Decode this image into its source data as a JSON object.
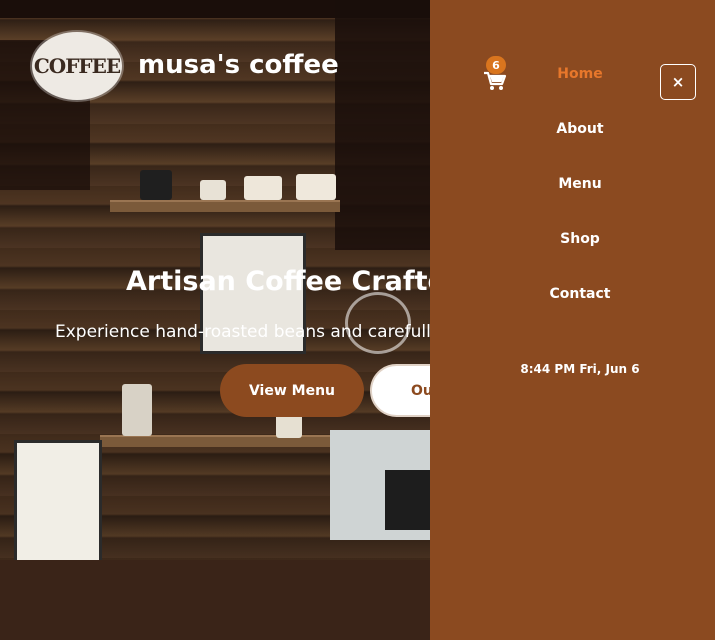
{
  "brand": {
    "logo_text": "COFFEE",
    "name": "musa's coffee"
  },
  "hero": {
    "title": "Artisan Coffee Crafted",
    "subtitle": "Experience hand-roasted beans and carefully b",
    "primary_button": "View Menu",
    "secondary_button": "Our"
  },
  "cart": {
    "count": "6"
  },
  "nav": {
    "items": [
      {
        "label": "Home",
        "active": true
      },
      {
        "label": "About",
        "active": false
      },
      {
        "label": "Menu",
        "active": false
      },
      {
        "label": "Shop",
        "active": false
      },
      {
        "label": "Contact",
        "active": false
      }
    ]
  },
  "clock": {
    "text": "8:44 PM Fri, Jun 6"
  },
  "close": {
    "symbol": "×"
  },
  "colors": {
    "drawer_bg": "#8b4a20",
    "accent": "#e7772b",
    "button_brown": "#8c4a1f",
    "badge": "#d9751e"
  },
  "icons": {
    "cart": "cart-icon",
    "close": "close-icon"
  }
}
